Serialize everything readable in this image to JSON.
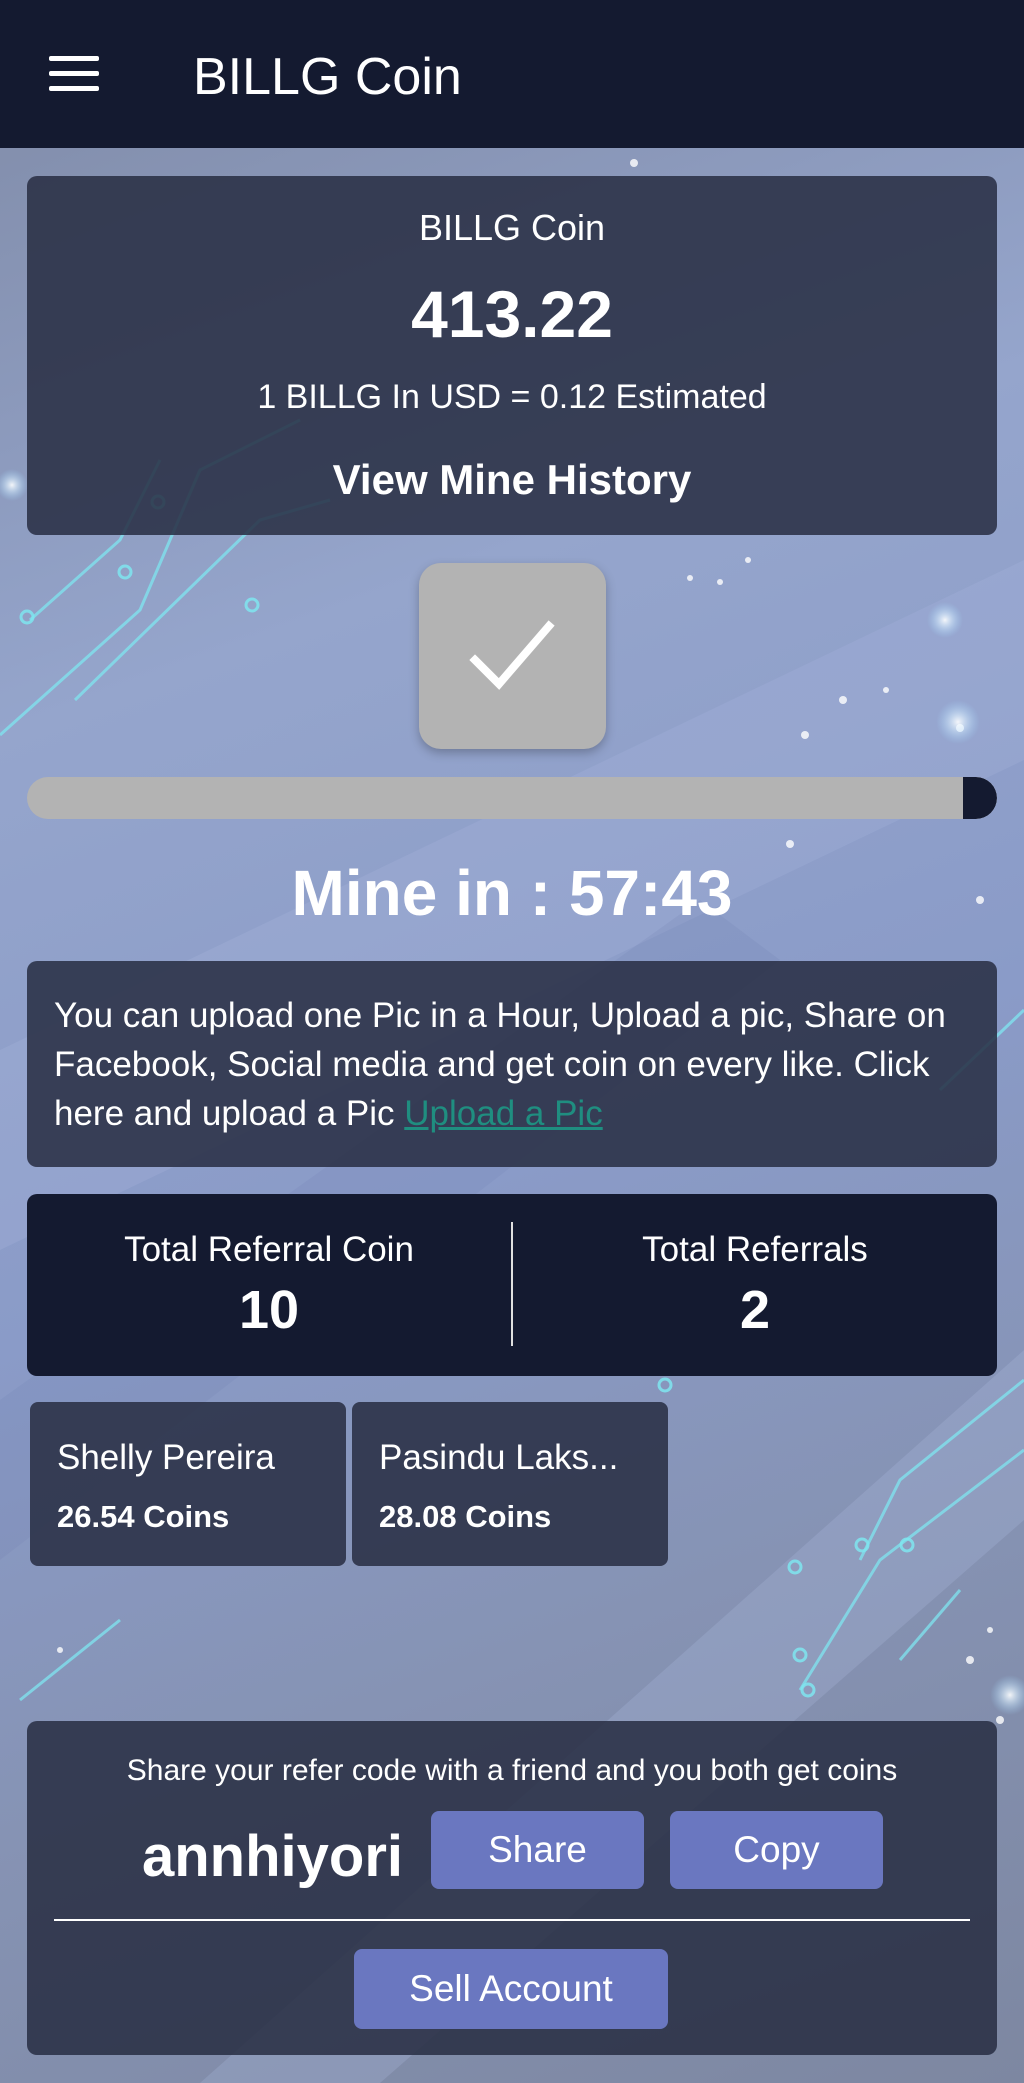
{
  "appbar": {
    "title": "BILLG Coin",
    "menu_icon": "hamburger-menu-icon"
  },
  "balance": {
    "label": "BILLG Coin",
    "amount": "413.22",
    "rate_text": "1 BILLG In USD = 0.12 Estimated",
    "history_link": "View Mine History"
  },
  "mining": {
    "button_icon": "checkmark-icon",
    "progress_percent": 96.5,
    "countdown": "Mine in : 57:43"
  },
  "upload": {
    "text": "You can upload one Pic in a Hour, Upload a pic, Share on Facebook, Social media and get coin on every like. Click here and upload a Pic ",
    "link_label": "Upload a Pic "
  },
  "referrals": {
    "coin_label": "Total Referral Coin",
    "coin_value": "10",
    "count_label": "Total Referrals",
    "count_value": "2",
    "friends": [
      {
        "name": "Shelly Pereira",
        "coins": "26.54 Coins"
      },
      {
        "name": "Pasindu Laks...",
        "coins": "28.08 Coins"
      }
    ]
  },
  "share": {
    "caption": "Share your refer code with a friend and you both get coins",
    "code": "annhiyori",
    "share_label": "Share",
    "copy_label": "Copy",
    "sell_label": "Sell Account"
  },
  "colors": {
    "appbar": "#141a30",
    "card": "#282d42",
    "accent_button": "#6a77c0",
    "link": "#1f8e80",
    "progress_track": "#b3b3b3"
  }
}
